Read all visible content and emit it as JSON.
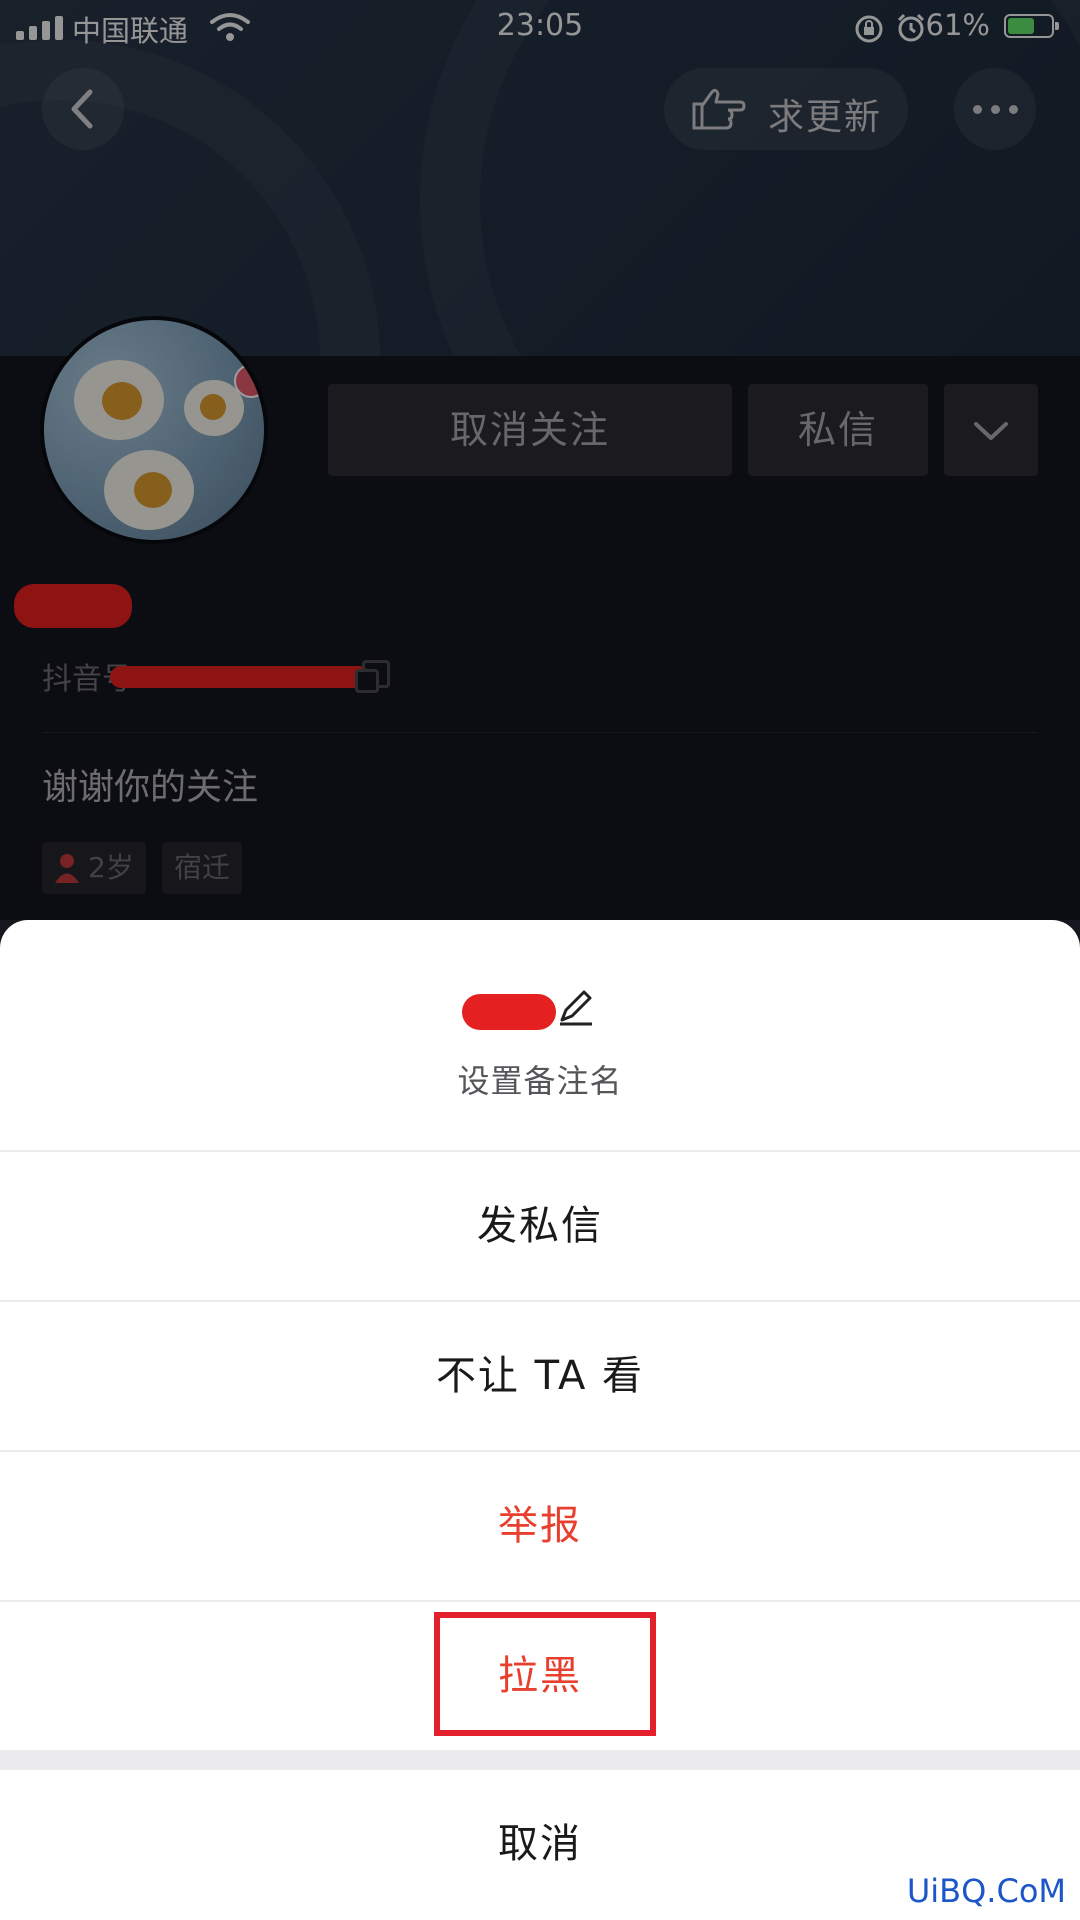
{
  "status_bar": {
    "carrier": "中国联通",
    "time": "23:05",
    "battery_percent": "61%",
    "battery_level": 0.61,
    "icons": [
      "signal-icon",
      "wifi-icon",
      "rotation-lock-icon",
      "alarm-icon",
      "battery-icon"
    ]
  },
  "nav": {
    "back_icon": "chevron-left-icon",
    "request_update_label": "求更新",
    "request_update_icon": "pointing-hand-icon",
    "more_icon": "more-dots-icon"
  },
  "profile": {
    "unfollow_label": "取消关注",
    "message_label": "私信",
    "dropdown_icon": "chevron-down-icon",
    "id_prefix": "抖音号",
    "bio": "谢谢你的关注",
    "tags": {
      "age": "2岁",
      "location": "宿迁"
    }
  },
  "sheet": {
    "remark_label": "设置备注名",
    "items": [
      {
        "label": "发私信",
        "color": "#1a1a1a"
      },
      {
        "label": "不让 TA 看",
        "color": "#1a1a1a"
      },
      {
        "label": "举报",
        "color": "#e8402f"
      },
      {
        "label": "拉黑",
        "color": "#e8402f"
      }
    ],
    "cancel_label": "取消"
  },
  "watermark": "UiBQ.CoM",
  "colors": {
    "accent_red": "#e8402f",
    "highlight_box": "#e3202b",
    "button_bg": "#2a2b33",
    "page_bg": "#14151d"
  }
}
